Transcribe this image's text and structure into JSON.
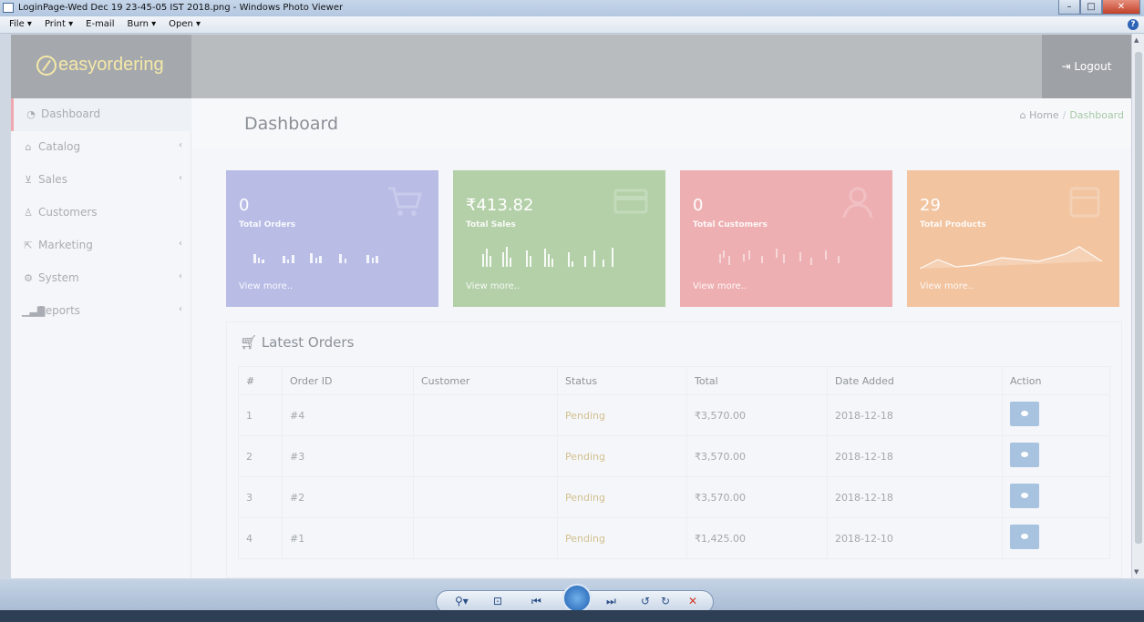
{
  "window": {
    "title": "LoginPage-Wed Dec 19 23-45-05 IST 2018.png - Windows Photo Viewer",
    "controls": [
      "minimize-icon",
      "maximize-icon",
      "close-icon"
    ]
  },
  "menubar": {
    "items": [
      "File ▾",
      "Print ▾",
      "E-mail",
      "Burn ▾",
      "Open ▾"
    ],
    "help_icon": "help-icon"
  },
  "app": {
    "logo_text": "easyordering",
    "logo_sub": "",
    "logout_label": "Logout",
    "colors": {
      "topbar": "#b9bcbf",
      "card_orders": "#b9bde6",
      "card_sales": "#b3d0a8",
      "card_customers": "#eeafb2",
      "card_products": "#f2c4a0",
      "action_button": "#a8c3df"
    }
  },
  "sidebar": {
    "items": [
      {
        "label": "Dashboard",
        "icon": "dashboard-icon",
        "active": true,
        "expandable": false
      },
      {
        "label": "Catalog",
        "icon": "tag-icon",
        "active": false,
        "expandable": true
      },
      {
        "label": "Sales",
        "icon": "cart-icon",
        "active": false,
        "expandable": true
      },
      {
        "label": "Customers",
        "icon": "user-icon",
        "active": false,
        "expandable": false
      },
      {
        "label": "Marketing",
        "icon": "share-icon",
        "active": false,
        "expandable": true
      },
      {
        "label": "System",
        "icon": "cog-icon",
        "active": false,
        "expandable": true
      },
      {
        "label": "Reports",
        "icon": "bar-chart-icon",
        "active": false,
        "expandable": true
      }
    ],
    "chevron": "‹"
  },
  "header": {
    "title": "Dashboard",
    "breadcrumb": {
      "home": "Home",
      "separator": "/",
      "current": "Dashboard"
    }
  },
  "cards": [
    {
      "value": "0",
      "label": "Total Orders",
      "more": "View more..",
      "icon": "cart-icon"
    },
    {
      "value": "₹413.82",
      "label": "Total Sales",
      "more": "View more..",
      "icon": "credit-card-icon"
    },
    {
      "value": "0",
      "label": "Total Customers",
      "more": "View more..",
      "icon": "user-icon"
    },
    {
      "value": "29",
      "label": "Total Products",
      "more": "View more..",
      "icon": "box-icon"
    }
  ],
  "orders": {
    "title": "Latest Orders",
    "columns": [
      "#",
      "Order ID",
      "Customer",
      "Status",
      "Total",
      "Date Added",
      "Action"
    ],
    "rows": [
      {
        "n": "1",
        "order_id": "#4",
        "customer": "",
        "status": "Pending",
        "total": "₹3,570.00",
        "date": "2018-12-18"
      },
      {
        "n": "2",
        "order_id": "#3",
        "customer": "",
        "status": "Pending",
        "total": "₹3,570.00",
        "date": "2018-12-18"
      },
      {
        "n": "3",
        "order_id": "#2",
        "customer": "",
        "status": "Pending",
        "total": "₹3,570.00",
        "date": "2018-12-18"
      },
      {
        "n": "4",
        "order_id": "#1",
        "customer": "",
        "status": "Pending",
        "total": "₹1,425.00",
        "date": "2018-12-10"
      }
    ]
  },
  "viewer_controls": [
    "zoom-icon",
    "actual-size-icon",
    "previous-icon",
    "slideshow-icon",
    "next-icon",
    "rotate-left-icon",
    "rotate-right-icon",
    "delete-icon"
  ]
}
